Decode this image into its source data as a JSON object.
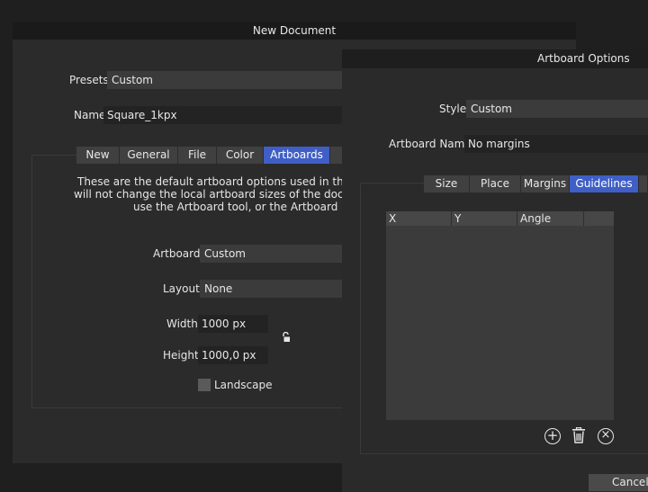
{
  "new_document": {
    "title": "New Document",
    "presets_label": "Presets",
    "presets_value": "Custom",
    "name_label": "Name",
    "name_value": "Square_1kpx",
    "tabs": [
      {
        "label": "New",
        "active": false
      },
      {
        "label": "General",
        "active": false
      },
      {
        "label": "File",
        "active": false
      },
      {
        "label": "Color",
        "active": false
      },
      {
        "label": "Artboards",
        "active": true
      }
    ],
    "info_lines": [
      "These are the default artboard options used in the canva",
      "will not change the local artboard sizes of the document c",
      "use the Artboard tool, or the Artboard"
    ],
    "artboard_label": "Artboard",
    "artboard_value": "Custom",
    "layout_label": "Layout",
    "layout_value": "None",
    "width_label": "Width",
    "width_value": "1000 px",
    "height_label": "Height",
    "height_value": "1000,0 px",
    "landscape_label": "Landscape",
    "landscape_checked": false
  },
  "artboard_options": {
    "title": "Artboard Options",
    "style_label": "Style",
    "style_value": "Custom",
    "artboard_name_label": "Artboard Name",
    "artboard_name_value": "No margins",
    "tabs": [
      {
        "label": "Size",
        "active": false
      },
      {
        "label": "Place",
        "active": false
      },
      {
        "label": "Margins",
        "active": false
      },
      {
        "label": "Guidelines",
        "active": true
      }
    ],
    "columns": [
      "X",
      "Y",
      "Angle",
      ""
    ],
    "cancel_label": "Cancel"
  },
  "icons": {
    "lock": "unlocked-lock-icon",
    "add": "add-circle-icon",
    "delete": "trash-icon",
    "clear": "clear-circle-icon"
  }
}
